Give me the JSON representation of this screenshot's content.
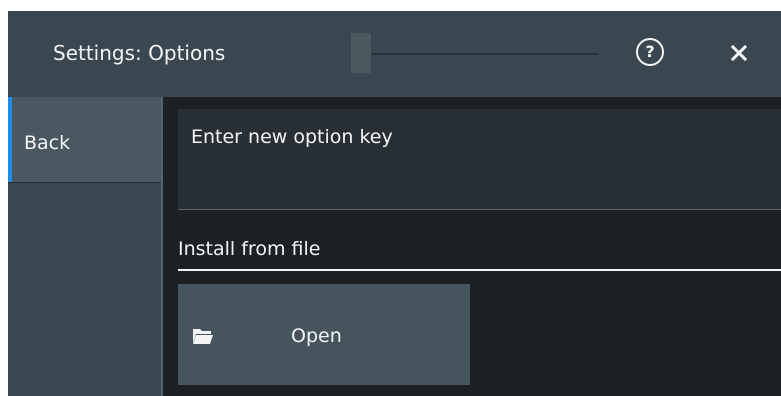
{
  "header": {
    "title": "Settings: Options",
    "help_icon": "help-icon",
    "close_icon": "close-icon"
  },
  "sidebar": {
    "items": [
      {
        "label": "Back"
      }
    ]
  },
  "option_key": {
    "label": "Enter new option key",
    "value": ""
  },
  "install": {
    "heading": "Install from file",
    "open_button_label": "Open",
    "open_icon": "folder-open-icon"
  },
  "colors": {
    "accent": "#1e8fe8",
    "titlebar": "#3b4750",
    "background": "#1c2125"
  }
}
